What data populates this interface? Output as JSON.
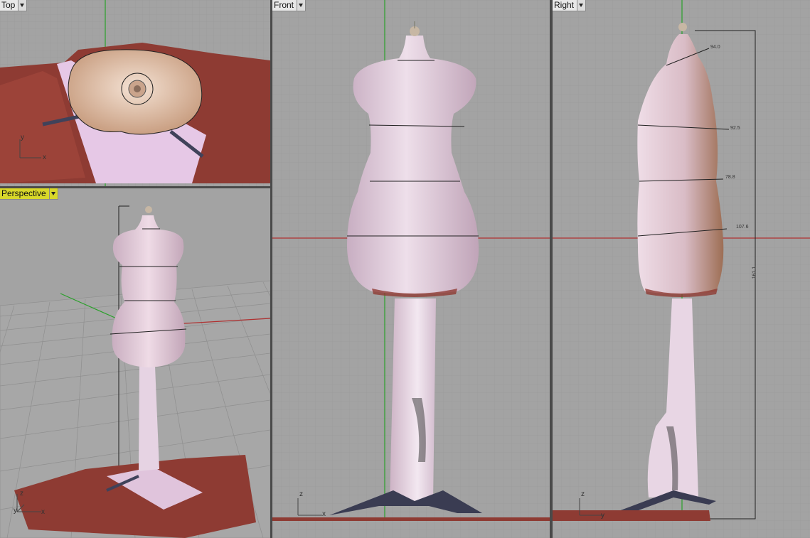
{
  "viewports": {
    "top": {
      "label": "Top"
    },
    "front": {
      "label": "Front"
    },
    "right": {
      "label": "Right"
    },
    "perspective": {
      "label": "Perspective"
    }
  },
  "axes": {
    "top": {
      "h": "x",
      "v": "y"
    },
    "front": {
      "h": "x",
      "v": "z"
    },
    "right": {
      "h": "y",
      "v": "z"
    },
    "perspective": {
      "h": "x",
      "v": "z",
      "d": "y"
    }
  },
  "dimensions": {
    "bust": "94.0",
    "waist": "92.5",
    "hip": "78.8",
    "low": "107.6",
    "height": "161.1"
  },
  "colors": {
    "viewport_bg": "#a3a3a3",
    "grid_minor": "#9a9a9a",
    "grid_major": "#8c8c8c",
    "x_axis": "#b03030",
    "y_axis": "#2aa02a",
    "active_label": "#d8d82a",
    "mannequin": "#d9c3d0",
    "base": "#8a3a35"
  }
}
